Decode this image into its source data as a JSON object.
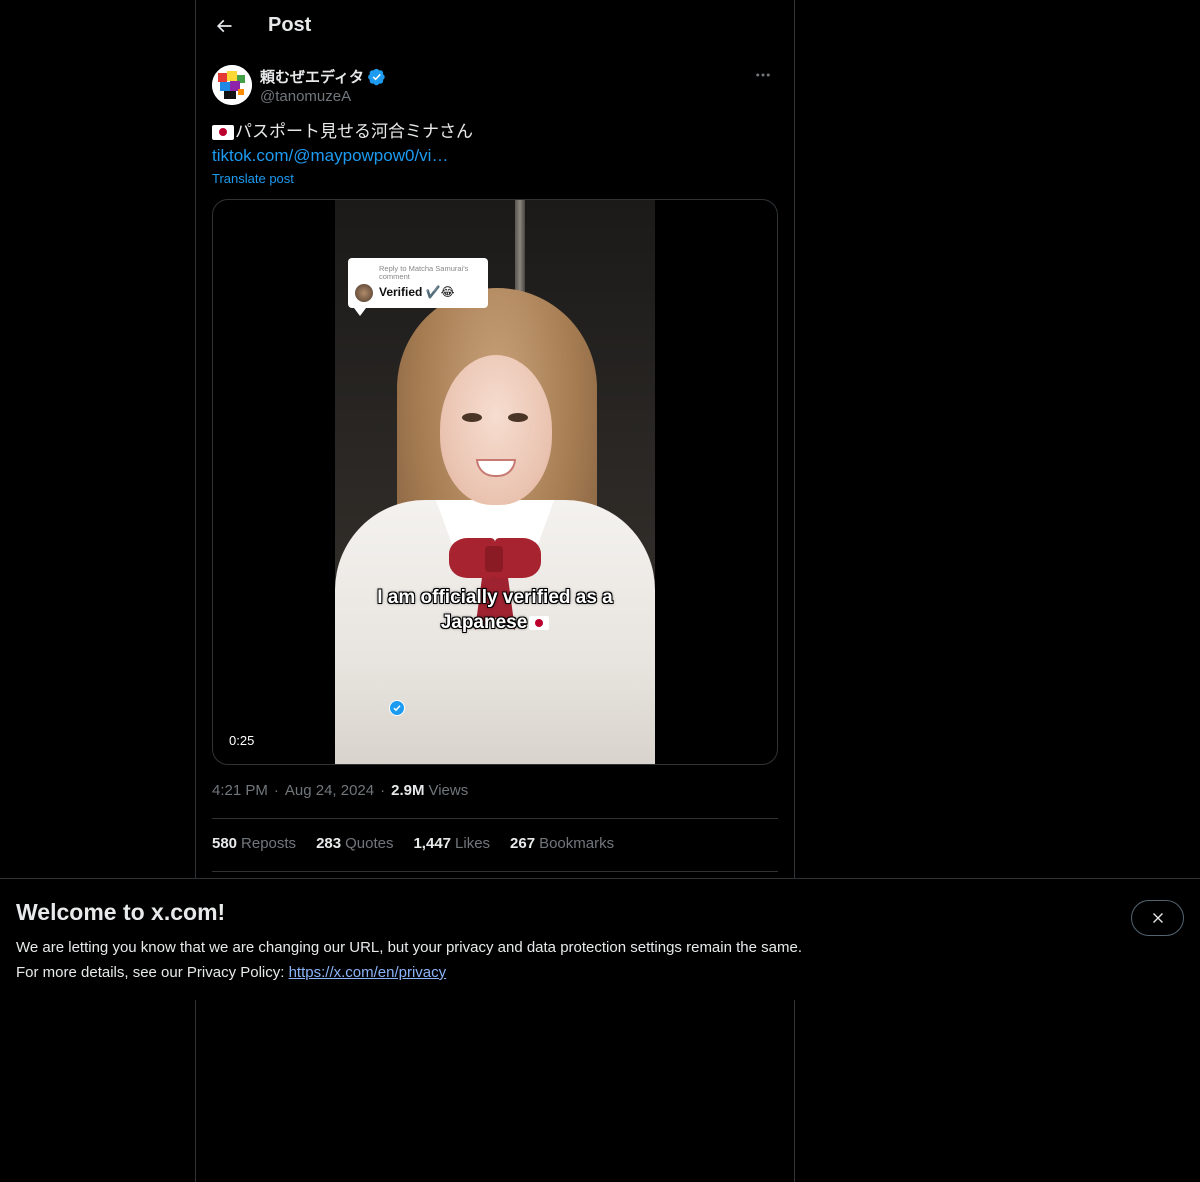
{
  "header": {
    "title": "Post",
    "back_icon": "arrow-left-icon"
  },
  "post": {
    "author": {
      "display_name": "頼むぜエディタ",
      "handle": "@tanomuzeA",
      "verified": true,
      "verified_color": "#1d9bf0"
    },
    "text_line": "パスポート見せる河合ミナさん",
    "flag_icon": "japan-flag-icon",
    "link_text": "tiktok.com/@maypowpow0/vi…",
    "translate_label": "Translate post",
    "media": {
      "comment_reply": "Reply to Matcha Samurai's comment",
      "comment_text": "Verified",
      "comment_emoji": "✔️😂",
      "caption_line1": "I am officially verified as a",
      "caption_line2": "Japanese",
      "duration": "0:25"
    },
    "time": "4:21 PM",
    "date": "Aug 24, 2024",
    "views_count": "2.9M",
    "views_label": "Views",
    "stats": [
      {
        "num": "580",
        "label": "Reposts"
      },
      {
        "num": "283",
        "label": "Quotes"
      },
      {
        "num": "1,447",
        "label": "Likes"
      },
      {
        "num": "267",
        "label": "Bookmarks"
      }
    ]
  },
  "banner": {
    "title": "Welcome to x.com!",
    "line1": "We are letting you know that we are changing our URL, but your privacy and data protection settings remain the same.",
    "line2_prefix": "For more details, see our Privacy Policy: ",
    "privacy_link": "https://x.com/en/privacy",
    "close_icon": "close-icon"
  },
  "colors": {
    "background": "#000000",
    "accent": "#1d9bf0",
    "muted_text": "#71767b",
    "border": "#2f3336"
  }
}
